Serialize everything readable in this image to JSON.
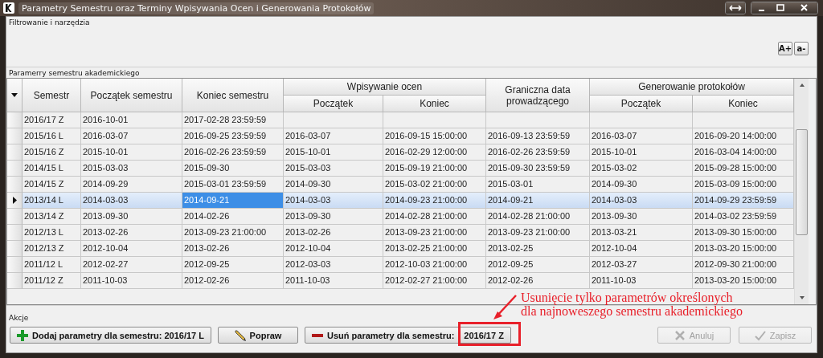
{
  "window": {
    "title": "Parametry Semestru oraz Terminy Wpisywania Ocen i Generowania Protokołów"
  },
  "filter_group": {
    "title": "Filtrowanie i narzędzia",
    "font_buttons": [
      {
        "label": "A+"
      },
      {
        "label": "a-"
      }
    ]
  },
  "table_group": {
    "title": "Paramerry semestru akademickiego"
  },
  "table": {
    "column_groups": [
      {
        "label": "Wpisywanie ocen"
      },
      {
        "label": "Generowanie protokołów"
      }
    ],
    "columns": [
      {
        "label": "Semestr",
        "grouped": false
      },
      {
        "label": "Początek semestru",
        "grouped": false
      },
      {
        "label": "Koniec semestru",
        "grouped": false
      },
      {
        "label": "Początek",
        "grouped": true
      },
      {
        "label": "Koniec",
        "grouped": true
      },
      {
        "label": "Graniczna data prowadzącego",
        "grouped": false
      },
      {
        "label": "Początek",
        "grouped": true
      },
      {
        "label": "Koniec",
        "grouped": true
      }
    ],
    "rows": [
      {
        "selected": false,
        "cells": [
          "2016/17 Z",
          "2016-10-01",
          "2017-02-28 23:59:59"
        ],
        "cell_focus": [
          false,
          false,
          false
        ]
      },
      {
        "selected": false,
        "cells": [
          "2015/16 L",
          "2016-03-07",
          "2016-09-25 23:59:59",
          "2016-03-07",
          "2016-09-15 15:00:00",
          "2016-09-13 23:59:59",
          "2016-03-07",
          "2016-09-20 14:00:00"
        ],
        "cell_focus": [
          false,
          false,
          false,
          false,
          false,
          false,
          false,
          false
        ]
      },
      {
        "selected": false,
        "cells": [
          "2015/16 Z",
          "2015-10-01",
          "2016-02-26 23:59:59",
          "2015-10-01",
          "2016-02-29 12:00:00",
          "2016-02-26 23:59:59",
          "2015-10-01",
          "2016-03-04 14:00:00"
        ],
        "cell_focus": [
          false,
          false,
          false,
          false,
          false,
          false,
          false,
          false
        ]
      },
      {
        "selected": false,
        "cells": [
          "2014/15 L",
          "2015-03-03",
          "2015-09-30",
          "2015-03-03",
          "2015-09-19 21:00:00",
          "2015-09-30 23:59:59",
          "2015-03-02",
          "2015-09-28 15:00:00"
        ],
        "cell_focus": [
          false,
          false,
          false,
          false,
          false,
          false,
          false,
          false
        ]
      },
      {
        "selected": false,
        "cells": [
          "2014/15 Z",
          "2014-09-29",
          "2015-03-01 23:59:59",
          "2014-09-30",
          "2015-03-02 21:00:00",
          "2015-03-01",
          "2014-09-30",
          "2015-03-09 15:00:00"
        ],
        "cell_focus": [
          false,
          false,
          false,
          false,
          false,
          false,
          false,
          false
        ]
      },
      {
        "selected": true,
        "cells": [
          "2013/14 L",
          "2014-03-03",
          "2014-09-21",
          "2014-03-03",
          "2014-09-23 21:00:00",
          "2014-09-21",
          "2014-03-03",
          "2014-09-29 23:59:59"
        ],
        "cell_focus": [
          false,
          false,
          true,
          false,
          false,
          false,
          false,
          false
        ]
      },
      {
        "selected": false,
        "cells": [
          "2013/14 Z",
          "2013-09-30",
          "2014-02-26",
          "2013-09-30",
          "2014-02-28 21:00:00",
          "2014-02-28 21:00:00",
          "2013-09-30",
          "2014-03-02 23:59:59"
        ],
        "cell_focus": [
          false,
          false,
          false,
          false,
          false,
          false,
          false,
          false
        ]
      },
      {
        "selected": false,
        "cells": [
          "2012/13 L",
          "2013-02-26",
          "2013-09-23 21:00:00",
          "2013-02-26",
          "2013-09-23 21:00:00",
          "2013-09-23 21:00:00",
          "2013-03-21",
          "2013-09-30 15:00:00"
        ],
        "cell_focus": [
          false,
          false,
          false,
          false,
          false,
          false,
          false,
          false
        ]
      },
      {
        "selected": false,
        "cells": [
          "2012/13 Z",
          "2012-10-04",
          "2013-02-26",
          "2012-10-04",
          "2013-02-25 21:00:00",
          "2013-02-25",
          "2012-10-04",
          "2013-03-20 15:00:00"
        ],
        "cell_focus": [
          false,
          false,
          false,
          false,
          false,
          false,
          false,
          false
        ]
      },
      {
        "selected": false,
        "cells": [
          "2011/12 L",
          "2012-02-27",
          "2012-09-25",
          "2012-03-03",
          "2012-10-03 21:00:00",
          "2012-09-25",
          "2012-03-27",
          "2012-09-30 21:00:00"
        ],
        "cell_focus": [
          false,
          false,
          false,
          false,
          false,
          false,
          false,
          false
        ]
      },
      {
        "selected": false,
        "cells": [
          "2011/12 Z",
          "2011-10-03",
          "2012-02-26",
          "2011-10-03",
          "2012-02-27 21:00:00",
          "2012-02-26",
          "2011-10-03",
          "2013-03-20 15:00:00"
        ],
        "cell_focus": [
          false,
          false,
          false,
          false,
          false,
          false,
          false,
          false
        ]
      }
    ]
  },
  "actions_group": {
    "title": "Akcje",
    "buttons": [
      {
        "kind": "add",
        "label": "Dodaj parametry dla semestru: 2016/17 L",
        "disabled": false
      },
      {
        "kind": "edit",
        "label": "Popraw",
        "disabled": false
      },
      {
        "kind": "delete",
        "label": "Usuń parametry dla semestru:",
        "value": "2016/17 Z",
        "disabled": false
      },
      {
        "kind": "cancel",
        "label": "Anuluj",
        "disabled": true
      },
      {
        "kind": "save",
        "label": "Zapisz",
        "disabled": true
      }
    ]
  },
  "annotation": {
    "lines": [
      "Usunięcie tylko parametrów określonych",
      "dla najnoweszego semestru akademickiego"
    ]
  }
}
